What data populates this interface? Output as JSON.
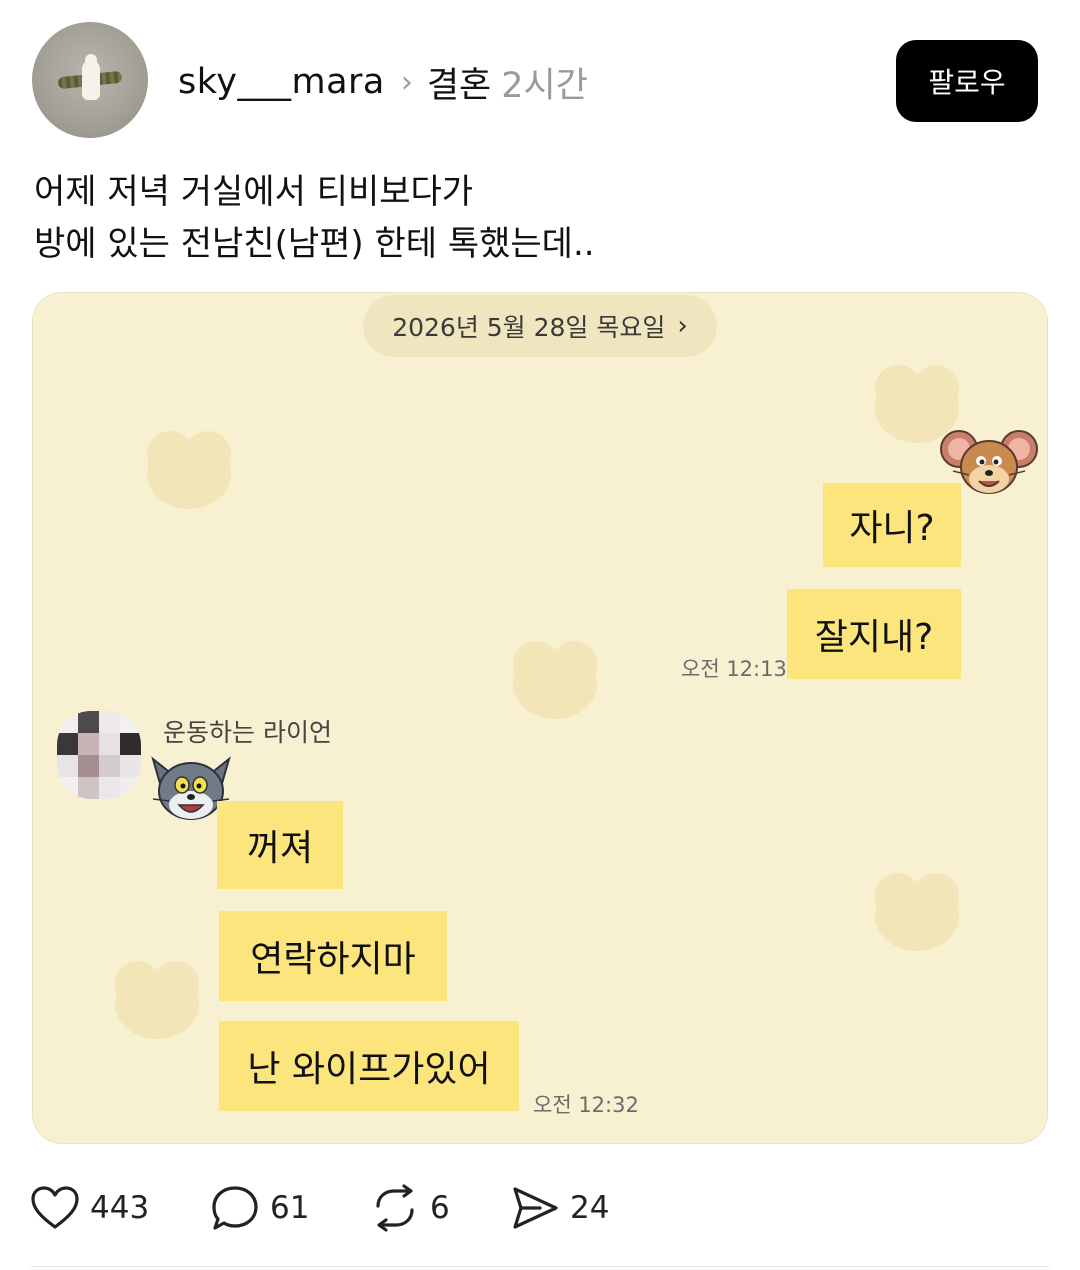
{
  "post": {
    "username": "sky___mara",
    "separator_icon": "chevron-right-icon",
    "topic": "결혼",
    "time": "2시간",
    "follow_label": "팔로우",
    "text_lines": [
      "어제 저녁 거실에서 티비보다가",
      "방에 있는 전남친(남편) 한테 톡했는데.."
    ]
  },
  "chat": {
    "date": "2026년 5월 28일 목요일",
    "outgoing": [
      {
        "text": "자니?"
      },
      {
        "text": "잘지내?"
      }
    ],
    "outgoing_time": "오전 12:13",
    "sender_name": "운동하는 라이언",
    "incoming": [
      {
        "text": "꺼져"
      },
      {
        "text": "연락하지마"
      },
      {
        "text": "난 와이프가있어"
      }
    ],
    "incoming_time": "오전 12:32",
    "colors": {
      "background": "#f8f1d1",
      "bubble": "#fde57e",
      "heart": "#f1e3b3"
    }
  },
  "actions": {
    "like_count": "443",
    "comment_count": "61",
    "repost_count": "6",
    "share_count": "24"
  }
}
